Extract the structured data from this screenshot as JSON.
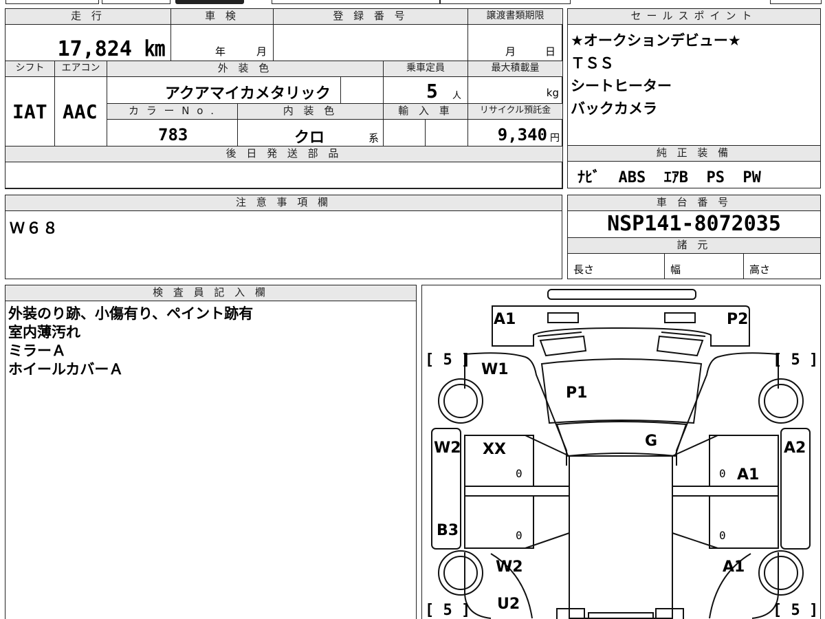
{
  "summary": {
    "mileage_label": "走 行",
    "mileage_value": "17,824 ㎞",
    "inspection_label": "車 検",
    "inspection_year_unit": "年",
    "inspection_month_unit": "月",
    "registration_label": "登 録 番 号",
    "transfer_deadline_label": "譲渡書類期限",
    "transfer_month_unit": "月",
    "transfer_day_unit": "日",
    "shift_label": "シフト",
    "shift_value": "IAT",
    "aircon_label": "エアコン",
    "aircon_value": "AAC",
    "exterior_color_label": "外 装 色",
    "exterior_color_value": "アクアマイカメタリック",
    "color_no_label": "カ ラ ー N o .",
    "color_no_value": "783",
    "interior_color_label": "内 装 色",
    "interior_color_value": "クロ",
    "interior_color_suffix": "系",
    "capacity_label": "乗車定員",
    "capacity_value": "5",
    "capacity_unit": "人",
    "max_load_label": "最大積載量",
    "max_load_unit": "kg",
    "import_label": "輸 入 車",
    "recycle_label": "リサイクル預託金",
    "recycle_value": "9,340",
    "recycle_unit": "円",
    "later_parts_label": "後 日 発 送 部 品"
  },
  "sales_points": {
    "label": "セールスポイント",
    "lines": [
      "★オークションデビュー★",
      "ＴＳＳ",
      "シートヒーター",
      "バックカメラ"
    ]
  },
  "equipment": {
    "label": "純 正 装 備",
    "value": "ﾅﾋﾞ  ABS  ｴｱB  PS  PW"
  },
  "notes": {
    "label": "注 意 事 項 欄",
    "value": "Ｗ６８"
  },
  "chassis": {
    "label": "車 台 番 号",
    "value": "NSP141-8072035",
    "specs_label": "諸 元",
    "length_label": "長さ",
    "width_label": "幅",
    "height_label": "高さ"
  },
  "inspector": {
    "label": "検 査 員 記 入 欄",
    "lines": [
      "外装のり跡、小傷有り、ペイント跡有",
      "室内薄汚れ",
      "ミラーＡ",
      "ホイールカバーＡ"
    ]
  },
  "diagram": {
    "front_left": "A1",
    "front_right": "P2",
    "hood": "P1",
    "left_front_fender": "W1",
    "left_front_door": "XX",
    "windshield": "G",
    "left_side_front": "W2",
    "right_side": "A2",
    "right_front_door": "A1",
    "left_rear_side": "B3",
    "left_rear_door": "W2",
    "right_rear_door": "A1",
    "left_rear": "U2",
    "zero1": "0",
    "zero2": "0",
    "zero3": "0",
    "zero4": "0",
    "bracket_tl": "[ 5 ]",
    "bracket_tr": "[ 5 ]",
    "bracket_bl": "[ 5 ]",
    "bracket_br": "[ 5 ]"
  }
}
